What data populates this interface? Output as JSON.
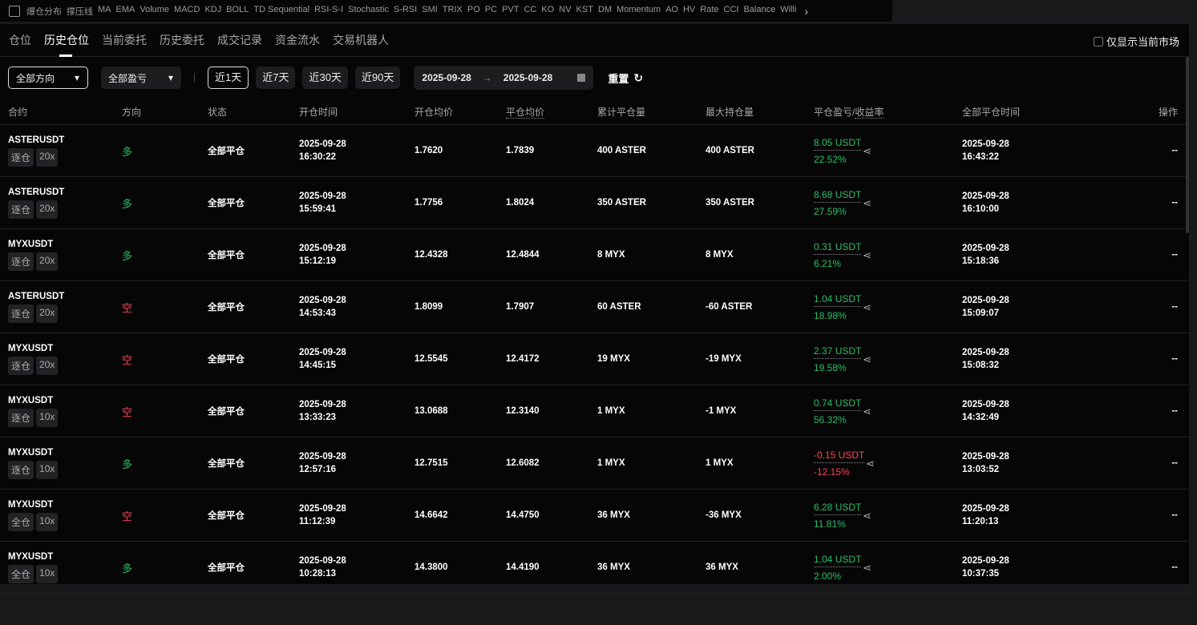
{
  "topbar": {
    "indicators": [
      "爆仓分布",
      "撑压线",
      "MA",
      "EMA",
      "Volume",
      "MACD",
      "KDJ",
      "BOLL",
      "TD Sequential",
      "RSI-S-I",
      "Stochastic",
      "S-RSI",
      "SMI",
      "TRIX",
      "PO",
      "PC",
      "PVT",
      "CC",
      "KO",
      "NV",
      "KST",
      "DM",
      "Momentum",
      "AO",
      "HV",
      "Rate",
      "CCI",
      "Balance",
      "Willi"
    ]
  },
  "tabs": [
    "仓位",
    "历史仓位",
    "当前委托",
    "历史委托",
    "成交记录",
    "资金流水",
    "交易机器人"
  ],
  "active_tab": 1,
  "only_current_market": "仅显示当前市场",
  "filters": {
    "direction": "全部方向",
    "pnl": "全部盈亏",
    "ranges": [
      "近1天",
      "近7天",
      "近30天",
      "近90天"
    ],
    "active_range": 0,
    "date_from": "2025-09-28",
    "date_to": "2025-09-28",
    "reset": "重置"
  },
  "columns": [
    "合约",
    "方向",
    "状态",
    "开仓时间",
    "开仓均价",
    "平仓均价",
    "累计平仓量",
    "最大持仓量",
    "平仓盈亏/收益率",
    "全部平仓时间",
    "操作"
  ],
  "colors": {
    "long": "#2ebd6b",
    "short": "#f6465d"
  },
  "rows": [
    {
      "symbol": "ASTERUSDT",
      "margin": "逐仓",
      "lev": "20x",
      "side": "多",
      "status": "全部平仓",
      "open_date": "2025-09-28",
      "open_time": "16:30:22",
      "open_price": "1.7620",
      "close_price": "1.7839",
      "closed_qty": "400 ASTER",
      "max_qty": "400 ASTER",
      "pnl": "8.05 USDT",
      "roi": "22.52%",
      "close_date": "2025-09-28",
      "close_time": "16:43:22",
      "op": "--"
    },
    {
      "symbol": "ASTERUSDT",
      "margin": "逐仓",
      "lev": "20x",
      "side": "多",
      "status": "全部平仓",
      "open_date": "2025-09-28",
      "open_time": "15:59:41",
      "open_price": "1.7756",
      "close_price": "1.8024",
      "closed_qty": "350 ASTER",
      "max_qty": "350 ASTER",
      "pnl": "8.68 USDT",
      "roi": "27.59%",
      "close_date": "2025-09-28",
      "close_time": "16:10:00",
      "op": "--"
    },
    {
      "symbol": "MYXUSDT",
      "margin": "逐仓",
      "lev": "20x",
      "side": "多",
      "status": "全部平仓",
      "open_date": "2025-09-28",
      "open_time": "15:12:19",
      "open_price": "12.4328",
      "close_price": "12.4844",
      "closed_qty": "8 MYX",
      "max_qty": "8 MYX",
      "pnl": "0.31 USDT",
      "roi": "6.21%",
      "close_date": "2025-09-28",
      "close_time": "15:18:36",
      "op": "--"
    },
    {
      "symbol": "ASTERUSDT",
      "margin": "逐仓",
      "lev": "20x",
      "side": "空",
      "status": "全部平仓",
      "open_date": "2025-09-28",
      "open_time": "14:53:43",
      "open_price": "1.8099",
      "close_price": "1.7907",
      "closed_qty": "60 ASTER",
      "max_qty": "-60 ASTER",
      "pnl": "1.04 USDT",
      "roi": "18.98%",
      "close_date": "2025-09-28",
      "close_time": "15:09:07",
      "op": "--"
    },
    {
      "symbol": "MYXUSDT",
      "margin": "逐仓",
      "lev": "20x",
      "side": "空",
      "status": "全部平仓",
      "open_date": "2025-09-28",
      "open_time": "14:45:15",
      "open_price": "12.5545",
      "close_price": "12.4172",
      "closed_qty": "19 MYX",
      "max_qty": "-19 MYX",
      "pnl": "2.37 USDT",
      "roi": "19.58%",
      "close_date": "2025-09-28",
      "close_time": "15:08:32",
      "op": "--"
    },
    {
      "symbol": "MYXUSDT",
      "margin": "逐仓",
      "lev": "10x",
      "side": "空",
      "status": "全部平仓",
      "open_date": "2025-09-28",
      "open_time": "13:33:23",
      "open_price": "13.0688",
      "close_price": "12.3140",
      "closed_qty": "1 MYX",
      "max_qty": "-1 MYX",
      "pnl": "0.74 USDT",
      "roi": "56.32%",
      "close_date": "2025-09-28",
      "close_time": "14:32:49",
      "op": "--"
    },
    {
      "symbol": "MYXUSDT",
      "margin": "逐仓",
      "lev": "10x",
      "side": "多",
      "status": "全部平仓",
      "open_date": "2025-09-28",
      "open_time": "12:57:16",
      "open_price": "12.7515",
      "close_price": "12.6082",
      "closed_qty": "1 MYX",
      "max_qty": "1 MYX",
      "pnl": "-0.15 USDT",
      "roi": "-12.15%",
      "close_date": "2025-09-28",
      "close_time": "13:03:52",
      "op": "--"
    },
    {
      "symbol": "MYXUSDT",
      "margin": "全仓",
      "lev": "10x",
      "side": "空",
      "status": "全部平仓",
      "open_date": "2025-09-28",
      "open_time": "11:12:39",
      "open_price": "14.6642",
      "close_price": "14.4750",
      "closed_qty": "36 MYX",
      "max_qty": "-36 MYX",
      "pnl": "6.28 USDT",
      "roi": "11.81%",
      "close_date": "2025-09-28",
      "close_time": "11:20:13",
      "op": "--"
    },
    {
      "symbol": "MYXUSDT",
      "margin": "全仓",
      "lev": "10x",
      "side": "多",
      "status": "全部平仓",
      "open_date": "2025-09-28",
      "open_time": "10:28:13",
      "open_price": "14.3800",
      "close_price": "14.4190",
      "closed_qty": "36 MYX",
      "max_qty": "36 MYX",
      "pnl": "1.04 USDT",
      "roi": "2.00%",
      "close_date": "2025-09-28",
      "close_time": "10:37:35",
      "op": "--"
    }
  ]
}
